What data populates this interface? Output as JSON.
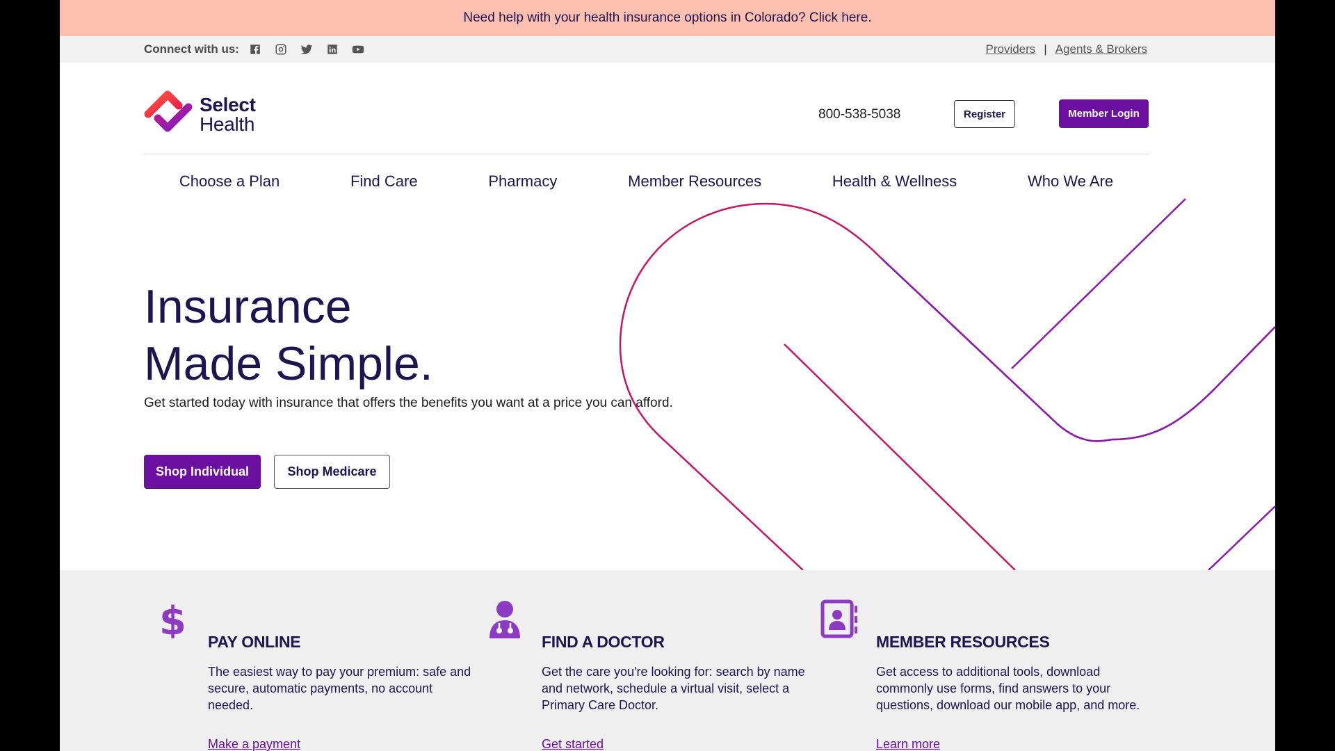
{
  "alert": {
    "text": "Need help with your health insurance options in Colorado? Click here."
  },
  "social": {
    "connect_label": "Connect with us:",
    "icons": [
      "facebook-icon",
      "instagram-icon",
      "twitter-icon",
      "linkedin-icon",
      "youtube-icon"
    ]
  },
  "top_links": {
    "providers": "Providers",
    "separator": "|",
    "agents": "Agents & Brokers"
  },
  "header": {
    "logo_line1": "Select",
    "logo_line2": "Health",
    "phone": "800-538-5038",
    "register": "Register",
    "member_login": "Member Login"
  },
  "nav": {
    "items": [
      "Choose a Plan",
      "Find Care",
      "Pharmacy",
      "Member Resources",
      "Health & Wellness",
      "Who We Are"
    ]
  },
  "hero": {
    "title_line1": "Insurance",
    "title_line2": "Made Simple.",
    "subtitle": "Get started today with insurance that offers the benefits you want at a price you can afford.",
    "shop_individual": "Shop Individual",
    "shop_medicare": "Shop Medicare"
  },
  "features": [
    {
      "icon": "dollar-icon",
      "title": "PAY ONLINE",
      "text": "The easiest way to pay your premium: safe and secure, automatic payments, no account needed.",
      "link": "Make a payment"
    },
    {
      "icon": "doctor-icon",
      "title": "FIND A DOCTOR",
      "text": "Get the care you're looking for: search by name and network, schedule a virtual visit, select a Primary Care Doctor.",
      "link": "Get started"
    },
    {
      "icon": "contact-book-icon",
      "title": "MEMBER RESOURCES",
      "text": "Get access to additional tools, download commonly use forms, find answers to your questions, download our mobile app, and more.",
      "link": "Learn more"
    }
  ],
  "colors": {
    "brand_purple": "#6a0fa0",
    "navy_text": "#1e1450",
    "alert_bg": "#fdbfb0",
    "band_bg": "#efefef",
    "deco_magenta": "#c71563",
    "deco_purple": "#8a1ab0"
  }
}
